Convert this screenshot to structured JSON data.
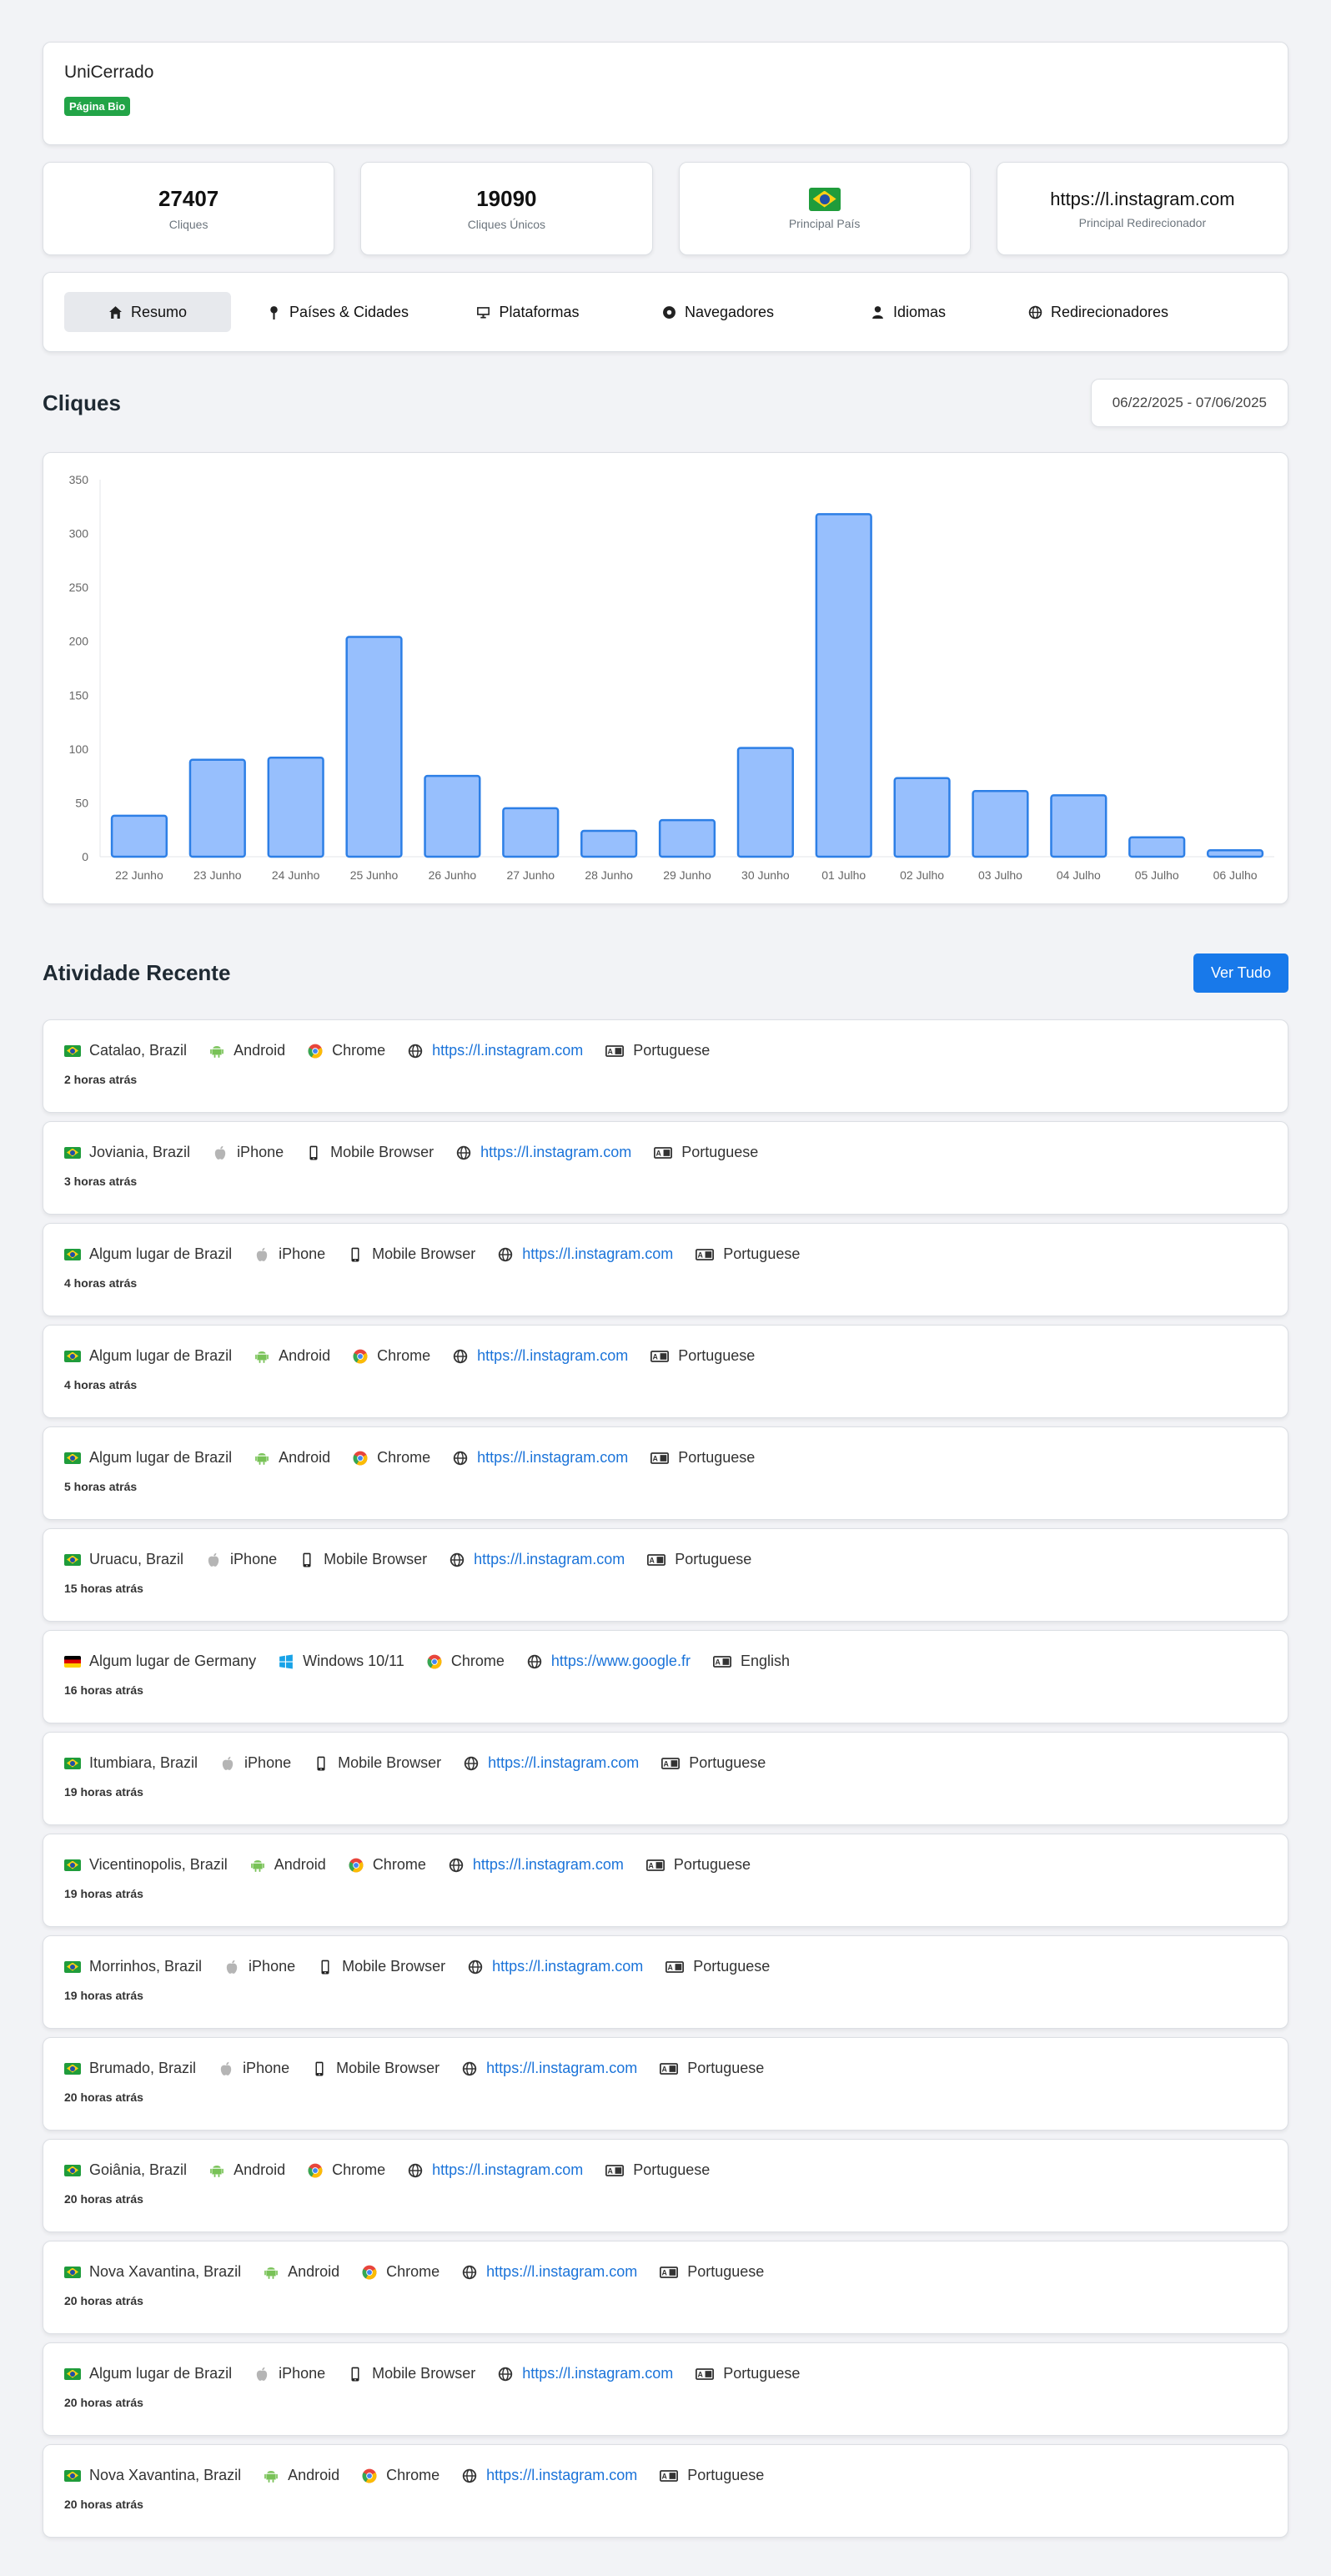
{
  "header": {
    "name": "UniCerrado",
    "badge": "Página Bio"
  },
  "stats": [
    {
      "value": "27407",
      "label": "Cliques"
    },
    {
      "value": "19090",
      "label": "Cliques Únicos"
    },
    {
      "icon": "brazil-flag",
      "label": "Principal País"
    },
    {
      "value": "https://l.instagram.com",
      "label": "Principal Redirecionador"
    }
  ],
  "tabs": [
    {
      "label": "Resumo",
      "icon": "home-icon"
    },
    {
      "label": "Países & Cidades",
      "icon": "map-pin-icon"
    },
    {
      "label": "Plataformas",
      "icon": "desktop-icon"
    },
    {
      "label": "Navegadores",
      "icon": "browser-icon"
    },
    {
      "label": "Idiomas",
      "icon": "user-icon"
    },
    {
      "label": "Redirecionadores",
      "icon": "globe-icon"
    }
  ],
  "cliques": {
    "title": "Cliques",
    "date_range": "06/22/2025 - 07/06/2025"
  },
  "chart_data": {
    "type": "bar",
    "categories": [
      "22 Junho",
      "23 Junho",
      "24 Junho",
      "25 Junho",
      "26 Junho",
      "27 Junho",
      "28 Junho",
      "29 Junho",
      "30 Junho",
      "01 Julho",
      "02 Julho",
      "03 Julho",
      "04 Julho",
      "05 Julho",
      "06 Julho"
    ],
    "values": [
      38,
      90,
      92,
      204,
      75,
      45,
      24,
      34,
      101,
      318,
      73,
      61,
      57,
      18,
      6
    ],
    "yticks": [
      0,
      50,
      100,
      150,
      200,
      250,
      300,
      350
    ],
    "ylim": [
      0,
      350
    ],
    "grid": false,
    "colors": {
      "fill": "#97bffd",
      "stroke": "#2d7fe6"
    }
  },
  "activity": {
    "title": "Atividade Recente",
    "see_all": "Ver Tudo",
    "items": [
      {
        "flag": "br",
        "location": "Catalao, Brazil",
        "os_icon": "android",
        "os": "Android",
        "browser_icon": "chrome",
        "browser": "Chrome",
        "referrer": "https://l.instagram.com",
        "language": "Portuguese",
        "time": "2 horas atrás"
      },
      {
        "flag": "br",
        "location": "Joviania, Brazil",
        "os_icon": "apple",
        "os": "iPhone",
        "browser_icon": "mobile",
        "browser": "Mobile Browser",
        "referrer": "https://l.instagram.com",
        "language": "Portuguese",
        "time": "3 horas atrás"
      },
      {
        "flag": "br",
        "location": "Algum lugar de Brazil",
        "os_icon": "apple",
        "os": "iPhone",
        "browser_icon": "mobile",
        "browser": "Mobile Browser",
        "referrer": "https://l.instagram.com",
        "language": "Portuguese",
        "time": "4 horas atrás"
      },
      {
        "flag": "br",
        "location": "Algum lugar de Brazil",
        "os_icon": "android",
        "os": "Android",
        "browser_icon": "chrome",
        "browser": "Chrome",
        "referrer": "https://l.instagram.com",
        "language": "Portuguese",
        "time": "4 horas atrás"
      },
      {
        "flag": "br",
        "location": "Algum lugar de Brazil",
        "os_icon": "android",
        "os": "Android",
        "browser_icon": "chrome",
        "browser": "Chrome",
        "referrer": "https://l.instagram.com",
        "language": "Portuguese",
        "time": "5 horas atrás"
      },
      {
        "flag": "br",
        "location": "Uruacu, Brazil",
        "os_icon": "apple",
        "os": "iPhone",
        "browser_icon": "mobile",
        "browser": "Mobile Browser",
        "referrer": "https://l.instagram.com",
        "language": "Portuguese",
        "time": "15 horas atrás"
      },
      {
        "flag": "de",
        "location": "Algum lugar de Germany",
        "os_icon": "windows",
        "os": "Windows 10/11",
        "browser_icon": "chrome",
        "browser": "Chrome",
        "referrer": "https://www.google.fr",
        "language": "English",
        "time": "16 horas atrás"
      },
      {
        "flag": "br",
        "location": "Itumbiara, Brazil",
        "os_icon": "apple",
        "os": "iPhone",
        "browser_icon": "mobile",
        "browser": "Mobile Browser",
        "referrer": "https://l.instagram.com",
        "language": "Portuguese",
        "time": "19 horas atrás"
      },
      {
        "flag": "br",
        "location": "Vicentinopolis, Brazil",
        "os_icon": "android",
        "os": "Android",
        "browser_icon": "chrome",
        "browser": "Chrome",
        "referrer": "https://l.instagram.com",
        "language": "Portuguese",
        "time": "19 horas atrás"
      },
      {
        "flag": "br",
        "location": "Morrinhos, Brazil",
        "os_icon": "apple",
        "os": "iPhone",
        "browser_icon": "mobile",
        "browser": "Mobile Browser",
        "referrer": "https://l.instagram.com",
        "language": "Portuguese",
        "time": "19 horas atrás"
      },
      {
        "flag": "br",
        "location": "Brumado, Brazil",
        "os_icon": "apple",
        "os": "iPhone",
        "browser_icon": "mobile",
        "browser": "Mobile Browser",
        "referrer": "https://l.instagram.com",
        "language": "Portuguese",
        "time": "20 horas atrás"
      },
      {
        "flag": "br",
        "location": "Goiânia, Brazil",
        "os_icon": "android",
        "os": "Android",
        "browser_icon": "chrome",
        "browser": "Chrome",
        "referrer": "https://l.instagram.com",
        "language": "Portuguese",
        "time": "20 horas atrás"
      },
      {
        "flag": "br",
        "location": "Nova Xavantina, Brazil",
        "os_icon": "android",
        "os": "Android",
        "browser_icon": "chrome",
        "browser": "Chrome",
        "referrer": "https://l.instagram.com",
        "language": "Portuguese",
        "time": "20 horas atrás"
      },
      {
        "flag": "br",
        "location": "Algum lugar de Brazil",
        "os_icon": "apple",
        "os": "iPhone",
        "browser_icon": "mobile",
        "browser": "Mobile Browser",
        "referrer": "https://l.instagram.com",
        "language": "Portuguese",
        "time": "20 horas atrás"
      },
      {
        "flag": "br",
        "location": "Nova Xavantina, Brazil",
        "os_icon": "android",
        "os": "Android",
        "browser_icon": "chrome",
        "browser": "Chrome",
        "referrer": "https://l.instagram.com",
        "language": "Portuguese",
        "time": "20 horas atrás"
      }
    ]
  }
}
